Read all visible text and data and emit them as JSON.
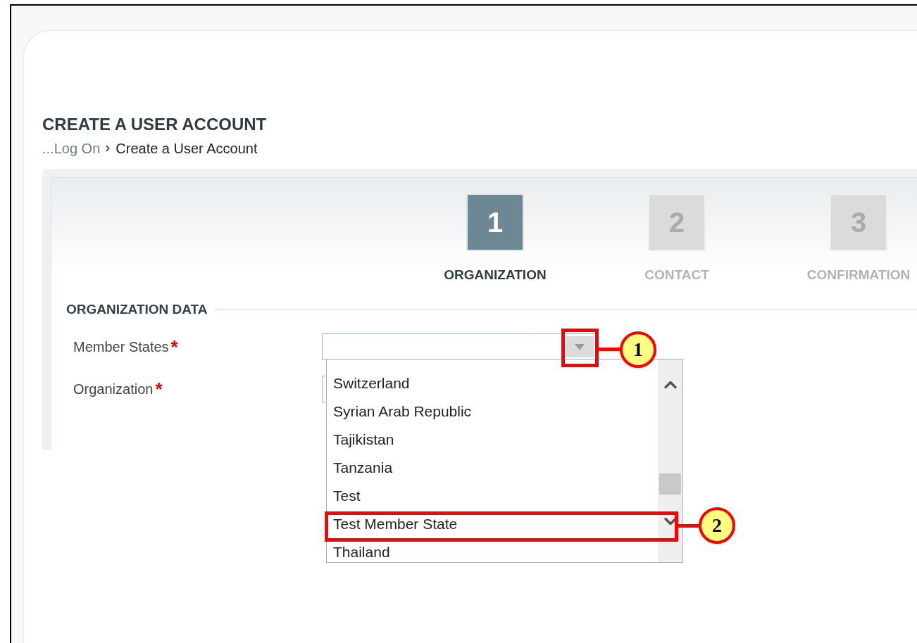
{
  "page": {
    "title": "CREATE A USER ACCOUNT"
  },
  "breadcrumb": [
    {
      "label": "...Log On",
      "link": true
    },
    {
      "label": "Create a User Account",
      "link": false
    }
  ],
  "steps": [
    {
      "number": "1",
      "label": "ORGANIZATION",
      "selected": true
    },
    {
      "number": "2",
      "label": "CONTACT",
      "selected": false
    },
    {
      "number": "3",
      "label": "CONFIRMATION",
      "selected": false
    }
  ],
  "section": {
    "title": "ORGANIZATION DATA"
  },
  "fields": [
    {
      "label": "Member States",
      "required": true,
      "kind": "dropdown"
    },
    {
      "label": "Organization",
      "required": true,
      "kind": "text"
    }
  ],
  "required_mark": "*",
  "dropdown": {
    "expanded": true,
    "options": [
      "Switzerland",
      "Syrian Arab Republic",
      "Tajikistan",
      "Tanzania",
      "Test",
      "Test Member State",
      "Thailand"
    ]
  },
  "callouts": [
    {
      "label": "1"
    },
    {
      "label": "2"
    }
  ]
}
